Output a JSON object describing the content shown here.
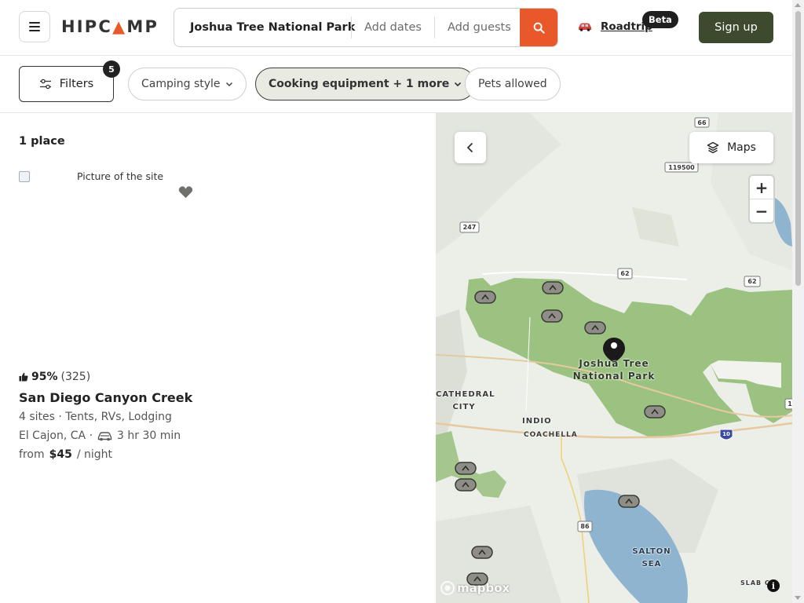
{
  "header": {
    "logo": "HIPCAMP",
    "search": {
      "location": "Joshua Tree National Park",
      "dates_placeholder": "Add dates",
      "guests_placeholder": "Add guests"
    },
    "roadtrip_label": "Roadtrip",
    "beta_badge": "Beta",
    "signup_label": "Sign up"
  },
  "filters": {
    "filters_label": "Filters",
    "filters_count": "5",
    "pills": [
      {
        "label": "Camping style",
        "active": false
      },
      {
        "label": "Cooking equipment + 1 more",
        "active": true
      },
      {
        "label": "Pets allowed",
        "active": false
      }
    ]
  },
  "results": {
    "count_label": "1 place",
    "listings": [
      {
        "image_alt": "Picture of the site",
        "rating_pct": "95%",
        "rating_count": "(325)",
        "name": "San Diego Canyon Creek",
        "sites": "4 sites · Tents, RVs, Lodging",
        "location": "El Cajon, CA ·",
        "drive_time": "3 hr 30 min",
        "price_prefix": "from",
        "price": "$45",
        "price_suffix": "/ night"
      }
    ]
  },
  "map": {
    "layers_label": "Maps",
    "zoom_in": "+",
    "zoom_out": "−",
    "attribution": "mapbox",
    "info": "i",
    "labels": {
      "park_line1": "Joshua Tree",
      "park_line2": "National Park",
      "cathedral_city_1": "CATHEDRAL",
      "cathedral_city_2": "CITY",
      "indio": "INDIO",
      "coachella": "COACHELLA",
      "salton_sea_1": "SALTON",
      "salton_sea_2": "SEA",
      "slab_city": "SLAB CI"
    },
    "shields": [
      "66",
      "119500",
      "247",
      "62",
      "62",
      "10",
      "86",
      "1"
    ]
  },
  "colors": {
    "accent": "#e8582b",
    "signup": "#3d4a2d",
    "park_green": "#9ac07e",
    "water": "#8fb4cf"
  }
}
